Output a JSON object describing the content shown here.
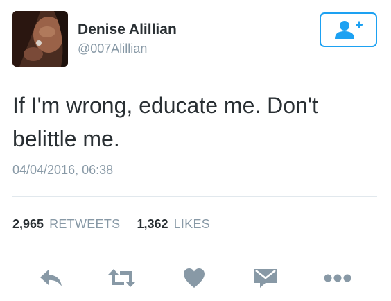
{
  "user": {
    "display_name": "Denise Alillian",
    "handle": "@007Alillian"
  },
  "tweet": {
    "text": "If I'm wrong, educate me. Don't belittle me.",
    "timestamp": "04/04/2016, 06:38"
  },
  "stats": {
    "retweets_count": "2,965",
    "retweets_label": "RETWEETS",
    "likes_count": "1,362",
    "likes_label": "LIKES"
  },
  "icons": {
    "follow": "add-user-icon",
    "reply": "reply-icon",
    "retweet": "retweet-icon",
    "like": "heart-icon",
    "message": "envelope-icon",
    "more": "more-icon"
  },
  "colors": {
    "accent": "#1da1f2",
    "text": "#292f33",
    "muted": "#8899a6",
    "icon": "#8899a6",
    "divider": "#e1e8ed"
  }
}
